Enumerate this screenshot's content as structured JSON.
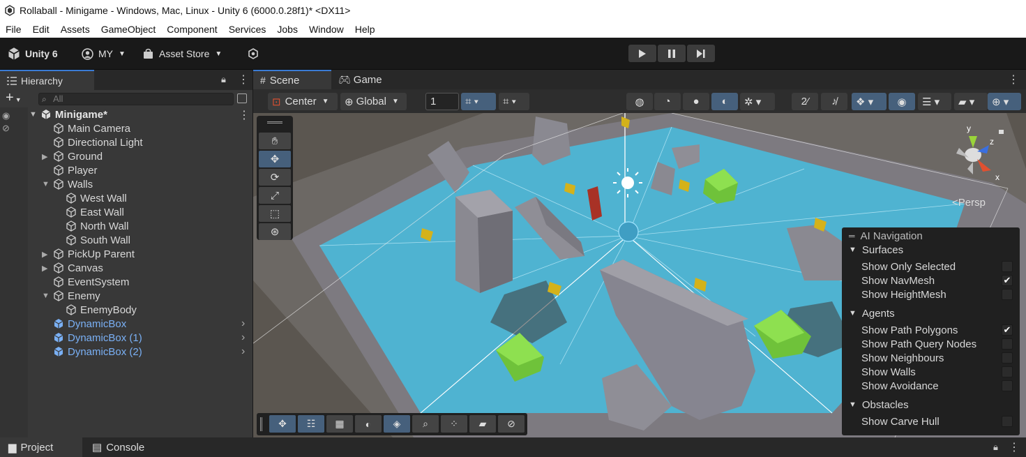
{
  "window": {
    "title": "Rollaball - Minigame - Windows, Mac, Linux - Unity 6 (6000.0.28f1)* <DX11>"
  },
  "menu": [
    "File",
    "Edit",
    "Assets",
    "GameObject",
    "Component",
    "Services",
    "Jobs",
    "Window",
    "Help"
  ],
  "toolbar": {
    "unity_label": "Unity 6",
    "account_label": "MY",
    "asset_store_label": "Asset Store"
  },
  "hierarchy": {
    "tab_label": "Hierarchy",
    "search_placeholder": "All",
    "root": "Minigame*",
    "items": [
      {
        "label": "Main Camera",
        "depth": 1,
        "expand": false,
        "blue": false
      },
      {
        "label": "Directional Light",
        "depth": 1,
        "expand": false,
        "blue": false
      },
      {
        "label": "Ground",
        "depth": 1,
        "expand": true,
        "blue": false
      },
      {
        "label": "Player",
        "depth": 1,
        "expand": false,
        "blue": false
      },
      {
        "label": "Walls",
        "depth": 1,
        "expand": true,
        "open": true,
        "blue": false
      },
      {
        "label": "West Wall",
        "depth": 2,
        "expand": false,
        "blue": false
      },
      {
        "label": "East Wall",
        "depth": 2,
        "expand": false,
        "blue": false
      },
      {
        "label": "North Wall",
        "depth": 2,
        "expand": false,
        "blue": false
      },
      {
        "label": "South Wall",
        "depth": 2,
        "expand": false,
        "blue": false
      },
      {
        "label": "PickUp Parent",
        "depth": 1,
        "expand": true,
        "blue": false
      },
      {
        "label": "Canvas",
        "depth": 1,
        "expand": true,
        "blue": false
      },
      {
        "label": "EventSystem",
        "depth": 1,
        "expand": false,
        "blue": false
      },
      {
        "label": "Enemy",
        "depth": 1,
        "expand": true,
        "open": true,
        "blue": false
      },
      {
        "label": "EnemyBody",
        "depth": 2,
        "expand": false,
        "blue": false
      },
      {
        "label": "DynamicBox",
        "depth": 1,
        "expand": false,
        "blue": true
      },
      {
        "label": "DynamicBox (1)",
        "depth": 1,
        "expand": false,
        "blue": true
      },
      {
        "label": "DynamicBox (2)",
        "depth": 1,
        "expand": false,
        "blue": true
      }
    ]
  },
  "scene": {
    "tabs": {
      "scene": "Scene",
      "game": "Game"
    },
    "pivot_label": "Center",
    "space_label": "Global",
    "grid_value": "1",
    "persp_label": "<Persp",
    "gizmo_axes": {
      "x": "x",
      "y": "y",
      "z": "z"
    }
  },
  "ai_navigation": {
    "title": "AI Navigation",
    "surfaces": {
      "label": "Surfaces",
      "items": [
        {
          "label": "Show Only Selected",
          "checked": false
        },
        {
          "label": "Show NavMesh",
          "checked": true
        },
        {
          "label": "Show HeightMesh",
          "checked": false
        }
      ]
    },
    "agents": {
      "label": "Agents",
      "items": [
        {
          "label": "Show Path Polygons",
          "checked": true
        },
        {
          "label": "Show Path Query Nodes",
          "checked": false
        },
        {
          "label": "Show Neighbours",
          "checked": false
        },
        {
          "label": "Show Walls",
          "checked": false
        },
        {
          "label": "Show Avoidance",
          "checked": false
        }
      ]
    },
    "obstacles": {
      "label": "Obstacles",
      "items": [
        {
          "label": "Show Carve Hull",
          "checked": false
        }
      ]
    }
  },
  "bottom_tabs": {
    "project": "Project",
    "console": "Console"
  },
  "colors": {
    "accent": "#3a7bd5",
    "navmesh": "#4fb3d1",
    "prefab_blue": "#7ab0f5",
    "pickup": "#d4b21a",
    "green_box": "#6fc23a",
    "enemy": "#a83226"
  }
}
